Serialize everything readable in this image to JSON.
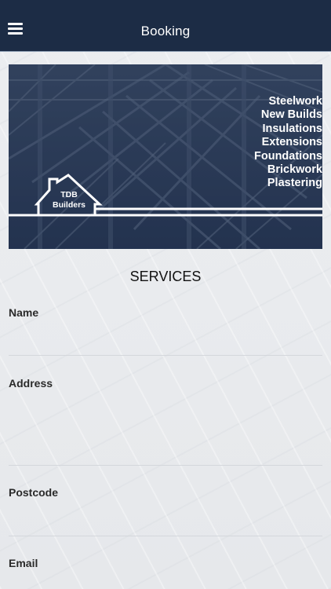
{
  "header": {
    "title": "Booking",
    "menu_icon": "hamburger-menu-icon",
    "background": "#1c2c45"
  },
  "banner": {
    "logo_line1": "TDB",
    "logo_line2": "Builders",
    "services": [
      "Steelwork",
      "New Builds",
      "Insulations",
      "Extensions",
      "Foundations",
      "Brickwork",
      "Plastering"
    ]
  },
  "section_title": "SERVICES",
  "form": {
    "name_label": "Name",
    "name_value": "",
    "address_label": "Address",
    "address_value": "",
    "postcode_label": "Postcode",
    "postcode_value": "",
    "email_label": "Email",
    "email_value": ""
  }
}
